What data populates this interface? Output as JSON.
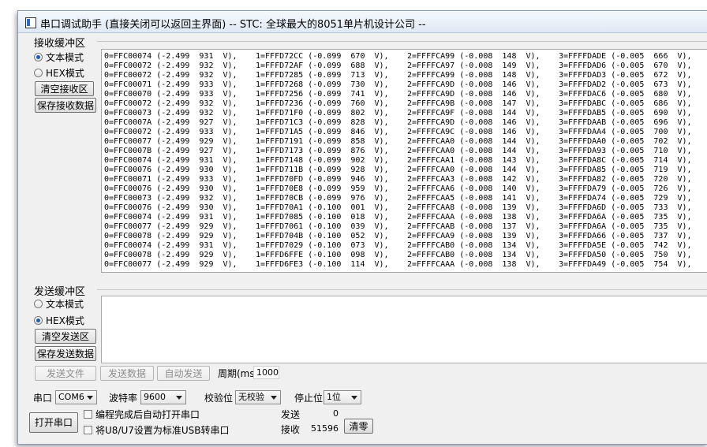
{
  "window": {
    "title": "串口调试助手 (直接关闭可以返回主界面) -- STC: 全球最大的8051单片机设计公司 --"
  },
  "receive": {
    "group_label": "接收缓冲区",
    "text_mode": "文本模式",
    "hex_mode": "HEX模式",
    "clear_button": "清空接收区",
    "save_button": "保存接收数据",
    "rows": [
      [
        "0=FFC00074 (-2.499  931  V),",
        "1=FFFD72CC (-0.099  670  V),",
        "2=FFFFCA99 (-0.008  148  V),",
        "3=FFFFDADE (-0.005  666  V),"
      ],
      [
        "0=FFC00072 (-2.499  932  V),",
        "1=FFFD72AF (-0.099  688  V),",
        "2=FFFFCA97 (-0.008  149  V),",
        "3=FFFFDAD6 (-0.005  670  V),"
      ],
      [
        "0=FFC00072 (-2.499  932  V),",
        "1=FFFD7285 (-0.099  713  V),",
        "2=FFFFCA99 (-0.008  148  V),",
        "3=FFFFDAD3 (-0.005  672  V),"
      ],
      [
        "0=FFC00071 (-2.499  933  V),",
        "1=FFFD7268 (-0.099  730  V),",
        "2=FFFFCA9D (-0.008  146  V),",
        "3=FFFFDAD2 (-0.005  673  V),"
      ],
      [
        "0=FFC00070 (-2.499  933  V),",
        "1=FFFD7256 (-0.099  741  V),",
        "2=FFFFCA9D (-0.008  146  V),",
        "3=FFFFDAC6 (-0.005  680  V),"
      ],
      [
        "0=FFC00072 (-2.499  932  V),",
        "1=FFFD7236 (-0.099  760  V),",
        "2=FFFFCA9B (-0.008  147  V),",
        "3=FFFFDABC (-0.005  686  V),"
      ],
      [
        "0=FFC00073 (-2.499  932  V),",
        "1=FFFD71F0 (-0.099  802  V),",
        "2=FFFFCA9F (-0.008  144  V),",
        "3=FFFFDAB5 (-0.005  690  V),"
      ],
      [
        "0=FFC0007A (-2.499  927  V),",
        "1=FFFD71C3 (-0.099  828  V),",
        "2=FFFFCA9D (-0.008  146  V),",
        "3=FFFFDAAB (-0.005  696  V),"
      ],
      [
        "0=FFC00072 (-2.499  933  V),",
        "1=FFFD71A5 (-0.099  846  V),",
        "2=FFFFCA9C (-0.008  146  V),",
        "3=FFFFDAA4 (-0.005  700  V),"
      ],
      [
        "0=FFC00077 (-2.499  929  V),",
        "1=FFFD7191 (-0.099  858  V),",
        "2=FFFFCAA0 (-0.008  144  V),",
        "3=FFFFDAA0 (-0.005  702  V),"
      ],
      [
        "0=FFC0007B (-2.499  927  V),",
        "1=FFFD7173 (-0.099  876  V),",
        "2=FFFFCAA0 (-0.008  144  V),",
        "3=FFFFDA93 (-0.005  710  V),"
      ],
      [
        "0=FFC00074 (-2.499  931  V),",
        "1=FFFD7148 (-0.099  902  V),",
        "2=FFFFCAA1 (-0.008  143  V),",
        "3=FFFFDA8C (-0.005  714  V),"
      ],
      [
        "0=FFC00076 (-2.499  930  V),",
        "1=FFFD711B (-0.099  928  V),",
        "2=FFFFCAA0 (-0.008  144  V),",
        "3=FFFFDA85 (-0.005  719  V),"
      ],
      [
        "0=FFC00071 (-2.499  933  V),",
        "1=FFFD70FD (-0.099  946  V),",
        "2=FFFFCAA3 (-0.008  142  V),",
        "3=FFFFDA82 (-0.005  720  V),"
      ],
      [
        "0=FFC00076 (-2.499  930  V),",
        "1=FFFD70E8 (-0.099  959  V),",
        "2=FFFFCAA6 (-0.008  140  V),",
        "3=FFFFDA79 (-0.005  726  V),"
      ],
      [
        "0=FFC00073 (-2.499  932  V),",
        "1=FFFD70CB (-0.099  976  V),",
        "2=FFFFCAA5 (-0.008  141  V),",
        "3=FFFFDA74 (-0.005  729  V),"
      ],
      [
        "0=FFC00076 (-2.499  930  V),",
        "1=FFFD70A1 (-0.100  001  V),",
        "2=FFFFCAA8 (-0.008  139  V),",
        "3=FFFFDA6D (-0.005  733  V),"
      ],
      [
        "0=FFC00074 (-2.499  931  V),",
        "1=FFFD7085 (-0.100  018  V),",
        "2=FFFFCAAA (-0.008  138  V),",
        "3=FFFFDA6A (-0.005  735  V),"
      ],
      [
        "0=FFC00077 (-2.499  929  V),",
        "1=FFFD7061 (-0.100  039  V),",
        "2=FFFFCAAB (-0.008  137  V),",
        "3=FFFFDA6A (-0.005  735  V),"
      ],
      [
        "0=FFC00078 (-2.499  929  V),",
        "1=FFFD704B (-0.100  052  V),",
        "2=FFFFCAA9 (-0.008  139  V),",
        "3=FFFFDA66 (-0.005  737  V),"
      ],
      [
        "0=FFC00074 (-2.499  931  V),",
        "1=FFFD7029 (-0.100  073  V),",
        "2=FFFFCAB0 (-0.008  134  V),",
        "3=FFFFDA5E (-0.005  742  V),"
      ],
      [
        "0=FFC00078 (-2.499  929  V),",
        "1=FFFD6FFE (-0.100  098  V),",
        "2=FFFFCAB0 (-0.008  134  V),",
        "3=FFFFDA50 (-0.005  750  V),"
      ],
      [
        "0=FFC00077 (-2.499  929  V),",
        "1=FFFD6FE3 (-0.100  114  V),",
        "2=FFFFCAAA (-0.008  138  V),",
        "3=FFFFDA49 (-0.005  754  V),"
      ]
    ]
  },
  "send": {
    "group_label": "发送缓冲区",
    "text_mode": "文本模式",
    "hex_mode": "HEX模式",
    "clear_button": "清空发送区",
    "save_button": "保存发送数据"
  },
  "send_controls": {
    "send_file": "发送文件",
    "send_data": "发送数据",
    "auto_send": "自动发送",
    "period_label": "周期(ms)",
    "period_value": "1000"
  },
  "serial": {
    "port_label": "串口",
    "port_value": "COM6",
    "baud_label": "波特率",
    "baud_value": "9600",
    "parity_label": "校验位",
    "parity_value": "无校验",
    "stop_label": "停止位",
    "stop_value": "1位",
    "open_button": "打开串口",
    "auto_open_label": "编程完成后自动打开串口",
    "usb_label": "将U8/U7设置为标准USB转串口",
    "sent_label": "发送",
    "sent_count": "0",
    "recv_label": "接收",
    "recv_count": "51596",
    "clear_count_button": "清零"
  },
  "colors": {
    "accent": "#1f5bb5",
    "window_bg": "#f0f0f0"
  }
}
